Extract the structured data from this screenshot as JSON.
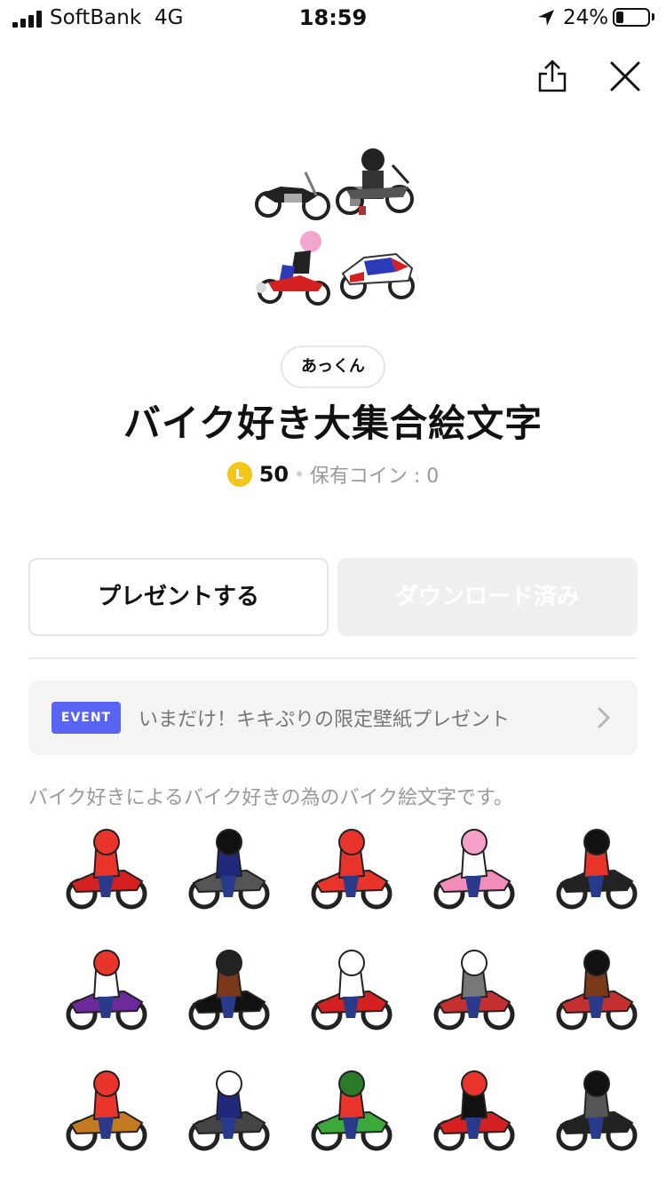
{
  "status_bar": {
    "carrier": "SoftBank",
    "network": "4G",
    "time": "18:59",
    "battery": "24%",
    "battery_level": 0.24,
    "icons": [
      "signal-icon",
      "location-icon",
      "battery-icon"
    ]
  },
  "header": {
    "icons": [
      "share-icon",
      "close-icon"
    ]
  },
  "pack": {
    "author": "あっくん",
    "title": "バイク好き大集合絵文字",
    "coin_symbol": "L",
    "price": "50",
    "separator": "•",
    "owned_coins": "保有コイン : 0"
  },
  "actions": {
    "gift_label": "プレゼントする",
    "download_label": "ダウンロード済み"
  },
  "event": {
    "badge": "EVENT",
    "text": "いまだけ！キキぷりの限定壁紙プレゼント"
  },
  "description": "バイク好きによるバイク好きの為のバイク絵文字です。",
  "colors": {
    "event_badge": "#5865f2",
    "coin": "#f5c518",
    "disabled_button": "#efefef"
  },
  "emojis": [
    {
      "helmet": "#e8342a",
      "jacket": "#e8342a",
      "bike": "#d42020"
    },
    {
      "helmet": "#111111",
      "jacket": "#1f2a7a",
      "bike": "#555555"
    },
    {
      "helmet": "#e8342a",
      "jacket": "#e8342a",
      "bike": "#e8342a"
    },
    {
      "helmet": "#f5a0c8",
      "jacket": "#ffffff",
      "bike": "#f28cb8"
    },
    {
      "helmet": "#111111",
      "jacket": "#e8342a",
      "bike": "#222222"
    },
    {
      "helmet": "#e8342a",
      "jacket": "#ffffff",
      "bike": "#6a2a9a"
    },
    {
      "helmet": "#222222",
      "jacket": "#7a3a1a",
      "bike": "#111111"
    },
    {
      "helmet": "#ffffff",
      "jacket": "#ffffff",
      "bike": "#d42020"
    },
    {
      "helmet": "#ffffff",
      "jacket": "#777777",
      "bike": "#c43030"
    },
    {
      "helmet": "#111111",
      "jacket": "#7a3a1a",
      "bike": "#c43030"
    },
    {
      "helmet": "#e8342a",
      "jacket": "#e8342a",
      "bike": "#c47a20"
    },
    {
      "helmet": "#ffffff",
      "jacket": "#1f2a7a",
      "bike": "#444444"
    },
    {
      "helmet": "#2a7a2a",
      "jacket": "#e8342a",
      "bike": "#3aa83a"
    },
    {
      "helmet": "#e8342a",
      "jacket": "#111111",
      "bike": "#d42020"
    },
    {
      "helmet": "#111111",
      "jacket": "#555555",
      "bike": "#222222"
    }
  ]
}
